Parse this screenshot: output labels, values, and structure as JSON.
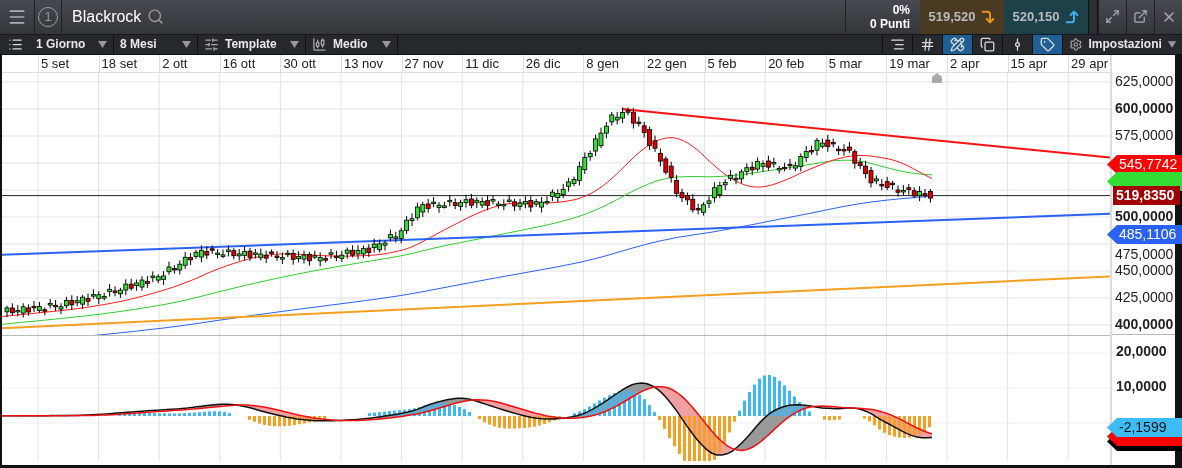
{
  "header": {
    "badge": "1",
    "title": "Blackrock",
    "change": "0%",
    "points": "0 Punti",
    "sell_price": "519,520",
    "buy_price": "520,150"
  },
  "toolbar": {
    "dropdowns": [
      {
        "label": "1 Giorno"
      },
      {
        "label": "8 Mesi"
      },
      {
        "label": "Template"
      },
      {
        "label": "Medio"
      }
    ],
    "tools": [
      {
        "selected": false
      },
      {
        "selected": false
      },
      {
        "selected": true
      },
      {
        "selected": false
      },
      {
        "selected": false
      },
      {
        "selected": true
      }
    ],
    "settings": "Impostazioni"
  },
  "date_axis": [
    "5 set",
    "18 set",
    "2 ott",
    "16 ott",
    "30 ott",
    "13 nov",
    "27 nov",
    "11 dic",
    "26 dic",
    "8 gen",
    "22 gen",
    "5 feb",
    "20 feb",
    "5 mar",
    "19 mar",
    "2 apr",
    "15 apr",
    "29 apr"
  ],
  "price_axis": [
    {
      "label": "625,0000",
      "major": false
    },
    {
      "label": "600,0000",
      "major": true
    },
    {
      "label": "575,0000",
      "major": false
    },
    {
      "label": "500,0000",
      "major": true
    },
    {
      "label": "475,0000",
      "major": false
    },
    {
      "label": "450,0000",
      "major": false
    },
    {
      "label": "425,0000",
      "major": false
    },
    {
      "label": "400,0000",
      "major": true
    }
  ],
  "price_tags": [
    {
      "label": "545,7742",
      "color": "#ff0000"
    },
    {
      "color": "#33dd33"
    },
    {
      "label": "519,8350",
      "color": "#a30000"
    },
    {
      "label": "485,1106",
      "color": "#2a62f5"
    }
  ],
  "macd_axis": [
    "20,0000",
    "10,0000"
  ],
  "macd_tags": [
    {
      "color": "#000000"
    },
    {
      "color": "#ff0000"
    },
    {
      "label": "-2,1599",
      "color": "#3dbdf7"
    }
  ]
}
